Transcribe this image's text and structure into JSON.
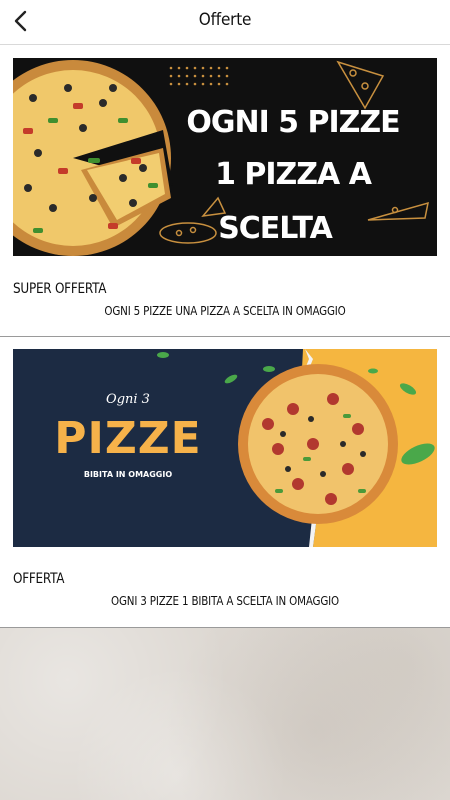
{
  "header": {
    "title": "Offerte",
    "back_icon": "chevron-left-icon"
  },
  "offers": [
    {
      "banner": {
        "lines": [
          "OGNI 5 PIZZE",
          "1 PIZZA A",
          "SCELTA"
        ],
        "background": "#0f0f0f",
        "text_color": "#ffffff",
        "accent": "#c8903f"
      },
      "title": "SUPER OFFERTA",
      "description": "OGNI 5 PIZZE UNA PIZZA A SCELTA IN OMAGGIO"
    },
    {
      "banner": {
        "kicker": "Ogni 3",
        "headline": "PIZZE",
        "subline": "BIBITA IN OMAGGIO",
        "background": "#1c2b43",
        "accent": "#f6b24a",
        "right_background": "#f5b640"
      },
      "title": "OFFERTA",
      "description": "OGNI 3 PIZZE 1 BIBITA A SCELTA IN OMAGGIO"
    }
  ]
}
